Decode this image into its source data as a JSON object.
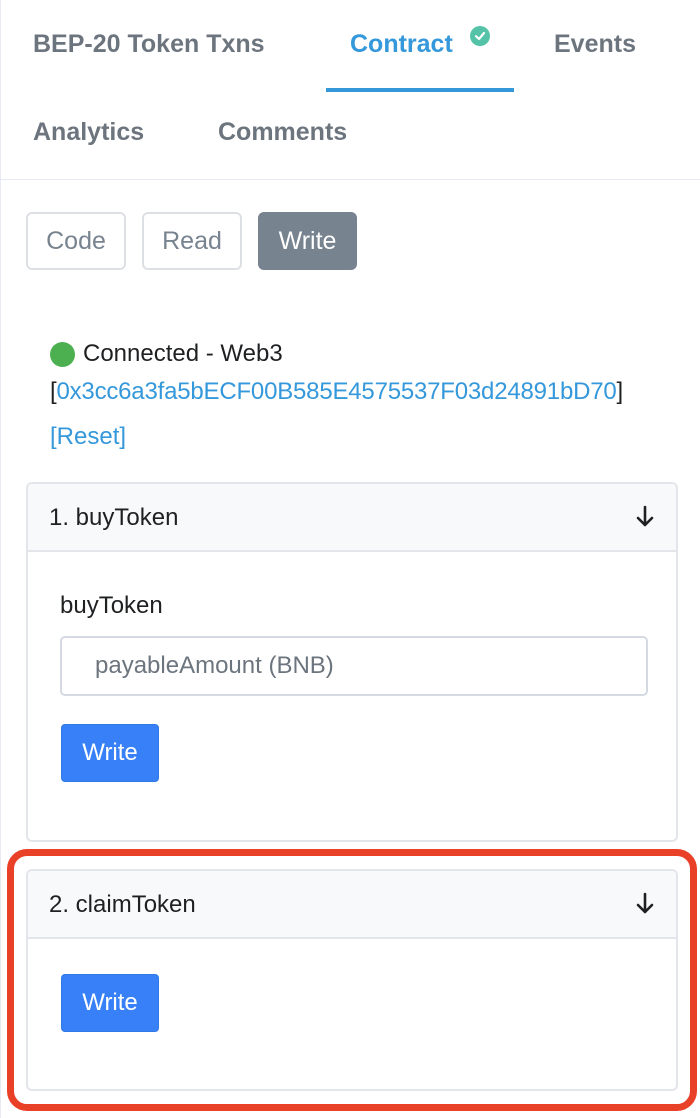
{
  "tabs": [
    {
      "label": "BEP-20 Token Txns",
      "active": false
    },
    {
      "label": "Contract",
      "active": true,
      "verified": true
    },
    {
      "label": "Events",
      "active": false
    },
    {
      "label": "Analytics",
      "active": false
    },
    {
      "label": "Comments",
      "active": false
    }
  ],
  "view_buttons": {
    "code": "Code",
    "read": "Read",
    "write": "Write",
    "active": "Write"
  },
  "connection": {
    "status": "Connected - Web3",
    "bracket_open": "[",
    "address": "0x3cc6a3fa5bECF00B585E4575537F03d24891bD70",
    "bracket_close": "]",
    "reset": "[Reset]",
    "status_color": "#4caf50"
  },
  "functions": [
    {
      "title": "1. buyToken",
      "input_label": "buyToken",
      "input_placeholder": "payableAmount (BNB)",
      "input_value": "",
      "button": "Write"
    },
    {
      "title": "2. claimToken",
      "button": "Write"
    }
  ],
  "colors": {
    "accent": "#3498db",
    "write_button": "#3880f8",
    "highlight": "#e84128",
    "verified": "#54c3a8"
  }
}
